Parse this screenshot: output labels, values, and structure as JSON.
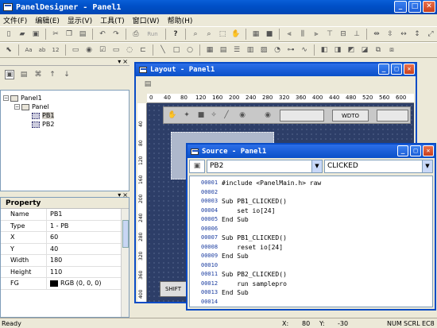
{
  "app": {
    "title": "PanelDesigner - Panel1"
  },
  "menu": [
    "文件(F)",
    "编辑(E)",
    "显示(V)",
    "工具(T)",
    "窗口(W)",
    "帮助(H)"
  ],
  "toolbar": {
    "run_label": "Run"
  },
  "tree": {
    "root": "Panel1",
    "child": "Panel",
    "items": [
      "PB1",
      "PB2"
    ]
  },
  "properties": {
    "title": "Property",
    "rows": [
      {
        "key": "Name",
        "value": "PB1"
      },
      {
        "key": "Type",
        "value": "1 - PB"
      },
      {
        "key": "X",
        "value": "60"
      },
      {
        "key": "Y",
        "value": "40"
      },
      {
        "key": "Width",
        "value": "180"
      },
      {
        "key": "Height",
        "value": "110"
      },
      {
        "key": "FG",
        "value": "RGB (0, 0, 0)"
      }
    ]
  },
  "layout": {
    "title": "Layout - Panel1",
    "ruler": [
      "0",
      "40",
      "80",
      "120",
      "160",
      "200",
      "240",
      "280",
      "320",
      "360",
      "400",
      "440",
      "480",
      "520",
      "560",
      "600"
    ],
    "vruler": [
      "40",
      "80",
      "120",
      "160",
      "200",
      "240",
      "280",
      "320",
      "360",
      "400"
    ],
    "wdt_label": "WDTO",
    "shift_label": "SHIFT"
  },
  "source": {
    "title": "Source - Panel1",
    "object": "PB2",
    "event": "CLICKED",
    "lines": [
      {
        "n": "00001",
        "t": "#include <PanelMain.h> raw"
      },
      {
        "n": "00002",
        "t": ""
      },
      {
        "n": "00003",
        "t": "Sub PB1_CLICKED()"
      },
      {
        "n": "00004",
        "t": "    set io[24]"
      },
      {
        "n": "00005",
        "t": "End Sub"
      },
      {
        "n": "00006",
        "t": ""
      },
      {
        "n": "00007",
        "t": "Sub PB1_CLICKED()"
      },
      {
        "n": "00008",
        "t": "    reset io[24]"
      },
      {
        "n": "00009",
        "t": "End Sub"
      },
      {
        "n": "00010",
        "t": ""
      },
      {
        "n": "00011",
        "t": "Sub PB2_CLICKED()"
      },
      {
        "n": "00012",
        "t": "    run samplepro"
      },
      {
        "n": "00013",
        "t": "End Sub"
      },
      {
        "n": "00014",
        "t": ""
      }
    ]
  },
  "status": {
    "text": "Ready",
    "x_label": "X:",
    "x_value": "80",
    "y_label": "Y:",
    "y_value": "-30",
    "num": "NUM",
    "scrl": "SCRL",
    "ec": "EC8"
  }
}
